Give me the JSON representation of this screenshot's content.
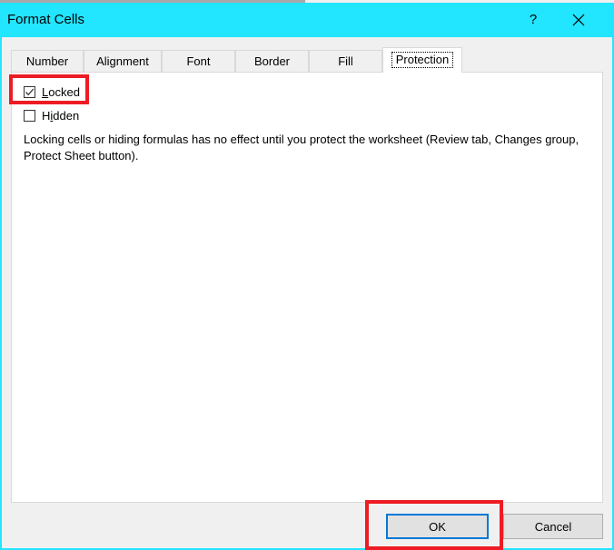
{
  "dialog": {
    "title": "Format Cells",
    "help_label": "?",
    "close_icon": "close-icon"
  },
  "tabs": [
    {
      "label": "Number",
      "active": false
    },
    {
      "label": "Alignment",
      "active": false
    },
    {
      "label": "Font",
      "active": false
    },
    {
      "label": "Border",
      "active": false
    },
    {
      "label": "Fill",
      "active": false
    },
    {
      "label": "Protection",
      "active": true
    }
  ],
  "protection": {
    "locked": {
      "label_first": "L",
      "label_rest": "ocked",
      "checked": true
    },
    "hidden": {
      "label_first": "H",
      "label_mid": "i",
      "label_rest": "dden",
      "checked": false
    },
    "description": "Locking cells or hiding formulas has no effect until you protect the worksheet (Review tab, Changes group, Protect Sheet button)."
  },
  "buttons": {
    "ok": "OK",
    "cancel": "Cancel"
  },
  "colors": {
    "titlebar": "#22e5ff",
    "highlight": "#ed1c24",
    "default_button_border": "#0078d7"
  }
}
